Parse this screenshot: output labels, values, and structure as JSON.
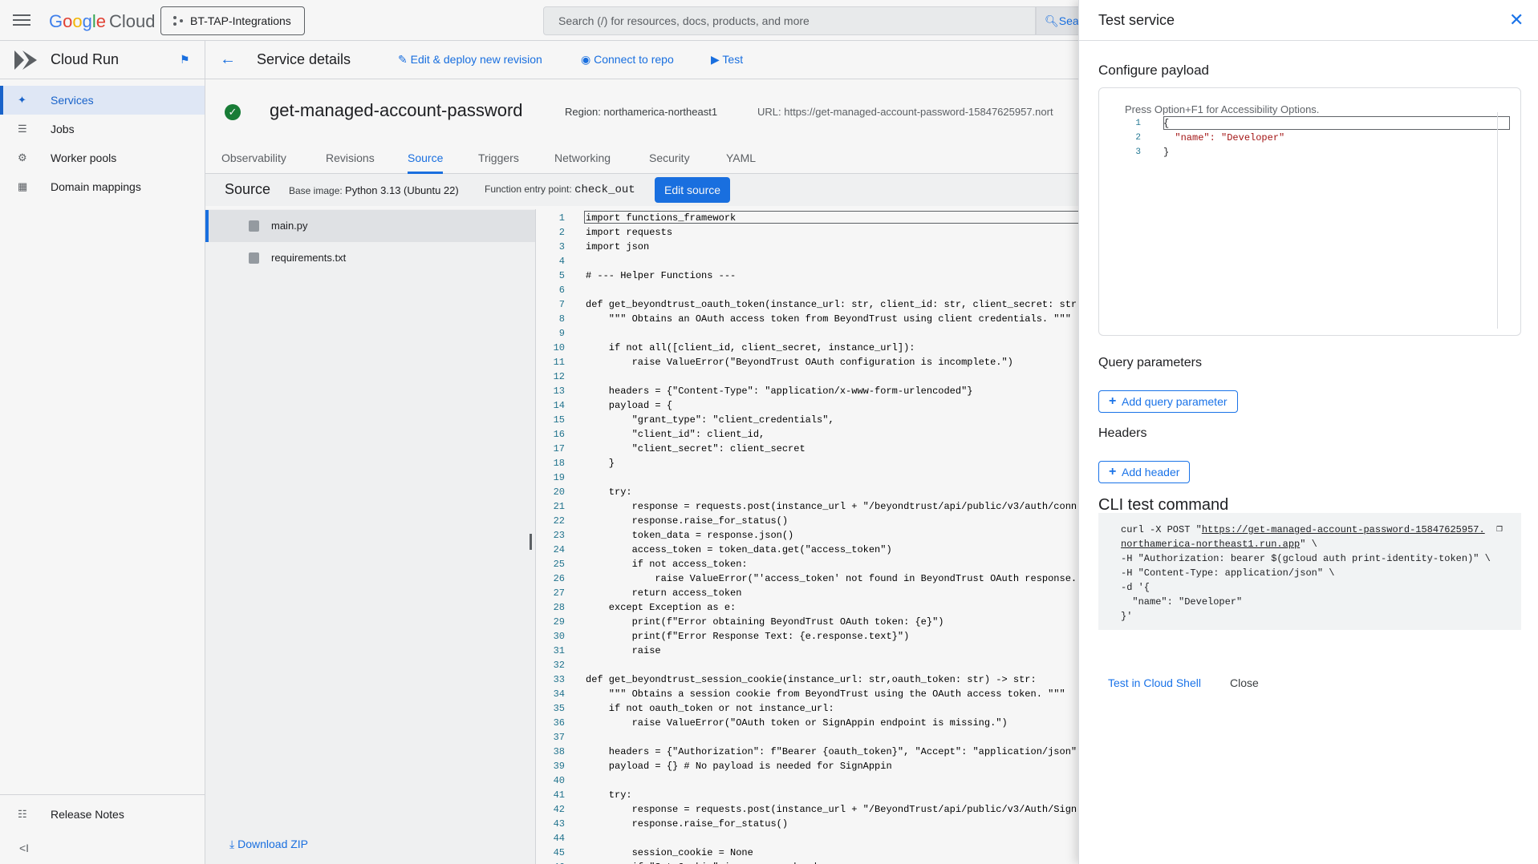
{
  "topbar": {
    "logo_google": [
      "G",
      "o",
      "o",
      "g",
      "l",
      "e"
    ],
    "logo_cloud": "Cloud",
    "project": "BT-TAP-Integrations",
    "search_placeholder": "Search (/) for resources, docs, products, and more",
    "search_button": "Sea"
  },
  "sidebar": {
    "product": "Cloud Run",
    "items": [
      {
        "label": "Services",
        "icon": "services-icon",
        "active": true
      },
      {
        "label": "Jobs",
        "icon": "list-icon",
        "active": false
      },
      {
        "label": "Worker pools",
        "icon": "gear-icon",
        "active": false
      },
      {
        "label": "Domain mappings",
        "icon": "grid-icon",
        "active": false
      }
    ],
    "release_notes": "Release Notes",
    "collapse": "<I"
  },
  "toolbar": {
    "title": "Service details",
    "edit_deploy": "Edit & deploy new revision",
    "connect_repo": "Connect to repo",
    "test": "Test"
  },
  "service": {
    "name": "get-managed-account-password",
    "region": "Region: northamerica-northeast1",
    "url_label": "URL: ",
    "url": "https://get-managed-account-password-15847625957.nort"
  },
  "tabs": [
    "Observability",
    "Revisions",
    "Source",
    "Triggers",
    "Networking",
    "Security",
    "YAML"
  ],
  "active_tab": "Source",
  "source": {
    "title": "Source",
    "base_image_label": "Base image: ",
    "base_image": "Python 3.13 (Ubuntu 22)",
    "entry_label": "Function entry point: ",
    "entry": "check_out",
    "edit_button": "Edit source",
    "files": [
      "main.py",
      "requirements.txt"
    ],
    "active_file": "main.py",
    "download": "Download ZIP"
  },
  "code_lines": [
    "import functions_framework",
    "import requests",
    "import json",
    "",
    "# --- Helper Functions ---",
    "",
    "def get_beyondtrust_oauth_token(instance_url: str, client_id: str, client_secret: str",
    "    \"\"\" Obtains an OAuth access token from BeyondTrust using client credentials. \"\"\"",
    "",
    "    if not all([client_id, client_secret, instance_url]):",
    "        raise ValueError(\"BeyondTrust OAuth configuration is incomplete.\")",
    "",
    "    headers = {\"Content-Type\": \"application/x-www-form-urlencoded\"}",
    "    payload = {",
    "        \"grant_type\": \"client_credentials\",",
    "        \"client_id\": client_id,",
    "        \"client_secret\": client_secret",
    "    }",
    "",
    "    try:",
    "        response = requests.post(instance_url + \"/beyondtrust/api/public/v3/auth/conn",
    "        response.raise_for_status()",
    "        token_data = response.json()",
    "        access_token = token_data.get(\"access_token\")",
    "        if not access_token:",
    "            raise ValueError(\"'access_token' not found in BeyondTrust OAuth response.",
    "        return access_token",
    "    except Exception as e:",
    "        print(f\"Error obtaining BeyondTrust OAuth token: {e}\")",
    "        print(f\"Error Response Text: {e.response.text}\")",
    "        raise",
    "",
    "def get_beyondtrust_session_cookie(instance_url: str,oauth_token: str) -> str:",
    "    \"\"\" Obtains a session cookie from BeyondTrust using the OAuth access token. \"\"\"",
    "    if not oauth_token or not instance_url:",
    "        raise ValueError(\"OAuth token or SignAppin endpoint is missing.\")",
    "",
    "    headers = {\"Authorization\": f\"Bearer {oauth_token}\", \"Accept\": \"application/json\"",
    "    payload = {} # No payload is needed for SignAppin",
    "",
    "    try:",
    "        response = requests.post(instance_url + \"/BeyondTrust/api/public/v3/Auth/Sign",
    "        response.raise_for_status()",
    "",
    "        session_cookie = None",
    "        if \"Set-Cookie\" in response.headers:"
  ],
  "panel": {
    "title": "Test service",
    "configure_payload": "Configure payload",
    "editor_hint": "Press Option+F1 for Accessibility Options.",
    "payload_lines": [
      "{",
      "  \"name\": \"Developer\"",
      "}"
    ],
    "query_params": "Query parameters",
    "add_query": "Add query parameter",
    "headers": "Headers",
    "add_header": "Add header",
    "cli_title": "CLI test command",
    "cli_lines": [
      "curl -X POST \"",
      "https://get-managed-account-password-15847625957.",
      "northamerica-northeast1.run.app",
      "\" \\",
      "-H \"Authorization: bearer $(gcloud auth print-identity-token)\" \\",
      "-H \"Content-Type: application/json\" \\",
      "-d '{",
      "  \"name\": \"Developer\"",
      "}'"
    ],
    "test_cloud_shell": "Test in Cloud Shell",
    "close": "Close"
  },
  "colors": {
    "accent": "#1a73e8",
    "success": "#188038",
    "active_nav_bg": "#e8f0fe"
  }
}
